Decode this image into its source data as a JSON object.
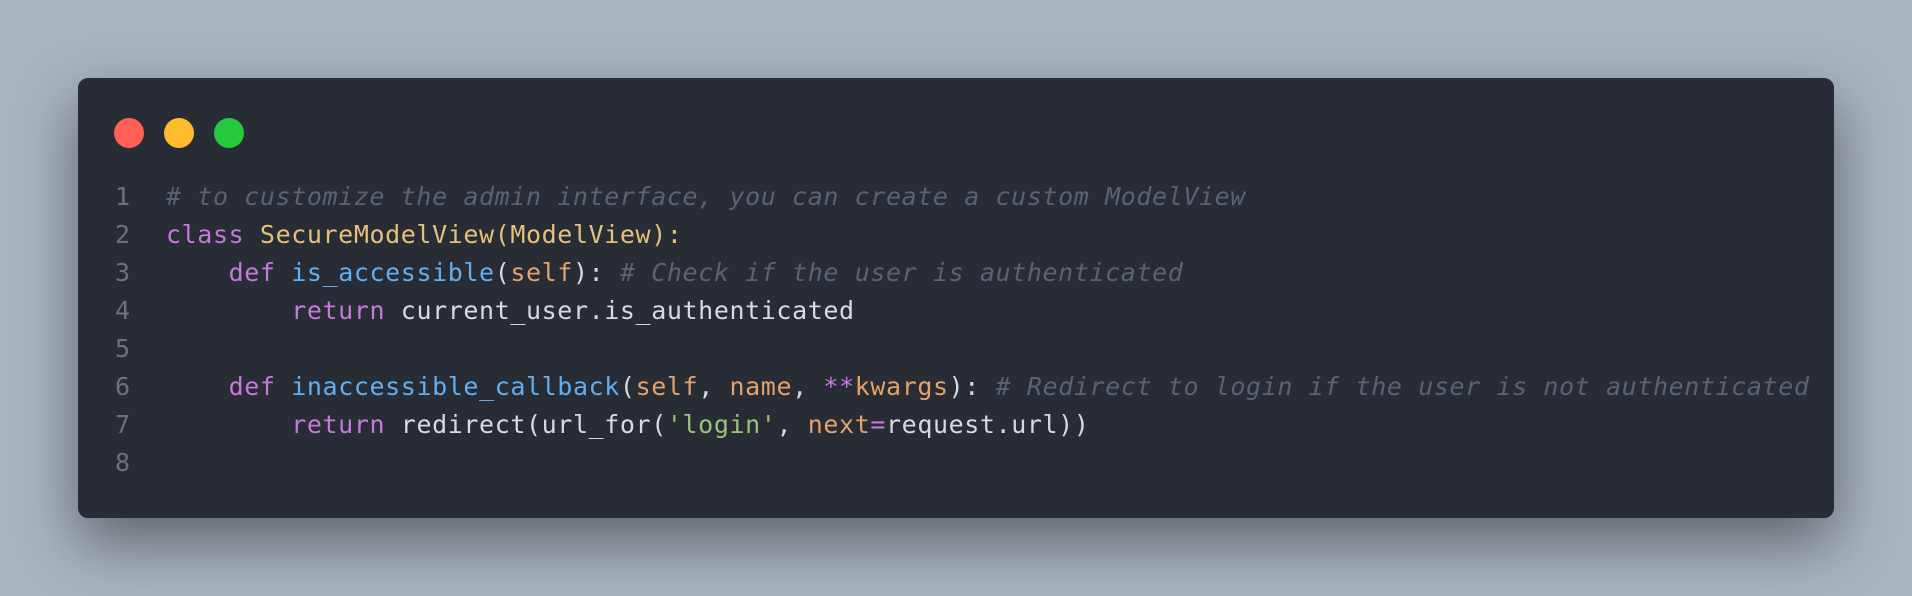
{
  "window": {
    "controls": [
      {
        "name": "close",
        "color": "#ff5f56"
      },
      {
        "name": "minimize",
        "color": "#ffbd2e"
      },
      {
        "name": "maximize",
        "color": "#27c93f"
      }
    ]
  },
  "code": {
    "language": "python",
    "lines": [
      {
        "num": "1",
        "tokens": [
          {
            "t": "# to customize the admin interface, you can create a custom ModelView",
            "c": "cm"
          }
        ]
      },
      {
        "num": "2",
        "tokens": [
          {
            "t": "class",
            "c": "kw"
          },
          {
            "t": " ",
            "c": ""
          },
          {
            "t": "SecureModelView(ModelView):",
            "c": "cls"
          }
        ]
      },
      {
        "num": "3",
        "tokens": [
          {
            "t": "    ",
            "c": ""
          },
          {
            "t": "def",
            "c": "kw"
          },
          {
            "t": " ",
            "c": ""
          },
          {
            "t": "is_accessible",
            "c": "fn"
          },
          {
            "t": "(",
            "c": ""
          },
          {
            "t": "self",
            "c": "param"
          },
          {
            "t": "): ",
            "c": ""
          },
          {
            "t": "# Check if the user is authenticated",
            "c": "cm"
          }
        ]
      },
      {
        "num": "4",
        "tokens": [
          {
            "t": "        ",
            "c": ""
          },
          {
            "t": "return",
            "c": "kw"
          },
          {
            "t": " current_user.is_authenticated",
            "c": ""
          }
        ]
      },
      {
        "num": "5",
        "tokens": []
      },
      {
        "num": "6",
        "tokens": [
          {
            "t": "    ",
            "c": ""
          },
          {
            "t": "def",
            "c": "kw"
          },
          {
            "t": " ",
            "c": ""
          },
          {
            "t": "inaccessible_callback",
            "c": "fn"
          },
          {
            "t": "(",
            "c": ""
          },
          {
            "t": "self",
            "c": "param"
          },
          {
            "t": ", ",
            "c": ""
          },
          {
            "t": "name",
            "c": "param"
          },
          {
            "t": ", ",
            "c": ""
          },
          {
            "t": "**",
            "c": "op"
          },
          {
            "t": "kwargs",
            "c": "param"
          },
          {
            "t": "): ",
            "c": ""
          },
          {
            "t": "# Redirect to login if the user is not authenticated",
            "c": "cm"
          }
        ]
      },
      {
        "num": "7",
        "tokens": [
          {
            "t": "        ",
            "c": ""
          },
          {
            "t": "return",
            "c": "kw"
          },
          {
            "t": " redirect(url_for(",
            "c": ""
          },
          {
            "t": "'login'",
            "c": "str"
          },
          {
            "t": ", ",
            "c": ""
          },
          {
            "t": "next",
            "c": "param"
          },
          {
            "t": "=",
            "c": "op"
          },
          {
            "t": "request.url))",
            "c": ""
          }
        ]
      },
      {
        "num": "8",
        "tokens": []
      }
    ]
  }
}
